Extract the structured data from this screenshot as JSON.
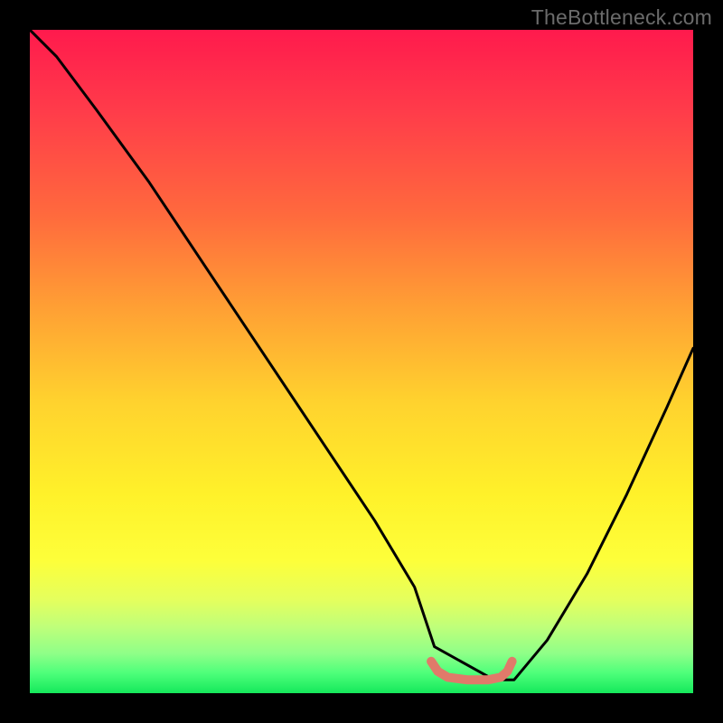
{
  "watermark": "TheBottleneck.com",
  "chart_data": {
    "type": "line",
    "title": "",
    "xlabel": "",
    "ylabel": "",
    "xlim": [
      0,
      100
    ],
    "ylim": [
      0,
      100
    ],
    "annotations": [],
    "background": {
      "gradient_top_color": "#ff1a4d",
      "gradient_mid_color": "#fff12a",
      "gradient_bottom_color": "#15e85b"
    },
    "series": [
      {
        "name": "bottleneck-curve",
        "type": "line",
        "color": "#000000",
        "x": [
          0,
          4,
          10,
          18,
          28,
          40,
          52,
          58,
          61,
          70,
          73,
          78,
          84,
          90,
          96,
          100
        ],
        "values": [
          100,
          96,
          88,
          77,
          62,
          44,
          26,
          16,
          7,
          2,
          2,
          8,
          18,
          30,
          43,
          52
        ]
      },
      {
        "name": "sweet-spot-marker",
        "type": "line",
        "color": "#e07a6a",
        "x": [
          60.5,
          61.5,
          63,
          66,
          69,
          71,
          72,
          72.7
        ],
        "values": [
          4.8,
          3.3,
          2.4,
          2.0,
          2.0,
          2.4,
          3.3,
          4.8
        ]
      }
    ]
  }
}
